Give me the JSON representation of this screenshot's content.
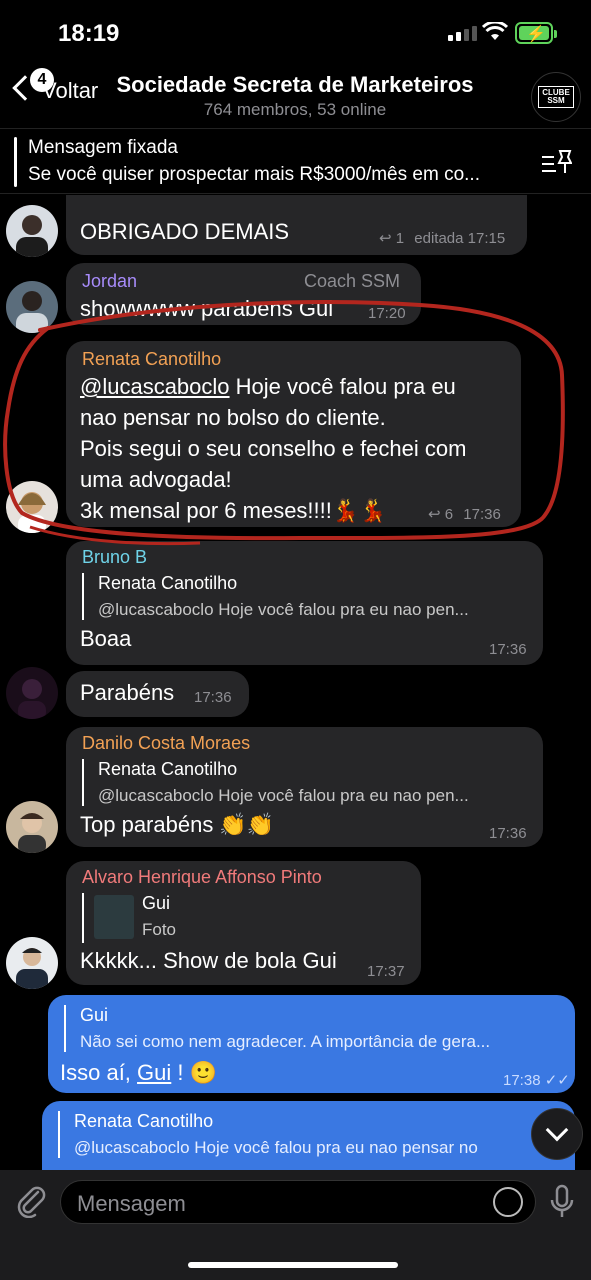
{
  "status": {
    "time": "18:19"
  },
  "header": {
    "back_label": "Voltar",
    "back_badge": "4",
    "title": "Sociedade Secreta de Marketeiros",
    "subtitle": "764 membros, 53 online",
    "avatar_text": "CLUBE SSM"
  },
  "pinned": {
    "title": "Mensagem fixada",
    "text": "Se você quiser prospectar mais R$3000/mês em co..."
  },
  "messages": [
    {
      "text": "OBRIGADO DEMAIS",
      "replies": "1",
      "edited": "editada",
      "time": "17:15"
    },
    {
      "sender": "Jordan",
      "badge": "Coach SSM",
      "text": "showwwww parabens Gui",
      "time": "17:20"
    },
    {
      "sender": "Renata Canotilho",
      "mention": "@lucascaboclo",
      "text1": " Hoje você falou pra eu",
      "text2": "nao pensar no bolso do cliente.",
      "text3": "Pois segui o seu conselho e fechei com",
      "text4": "uma advogada!",
      "text5": "3k mensal por 6 meses!!!!💃💃",
      "replies": "6",
      "time": "17:36"
    },
    {
      "sender": "Bruno B",
      "reply_name": "Renata Canotilho",
      "reply_text": "@lucascaboclo Hoje você falou pra eu nao pen...",
      "text": "Boaa",
      "time": "17:36"
    },
    {
      "text": "Parabéns",
      "time": "17:36"
    },
    {
      "sender": "Danilo Costa Moraes",
      "reply_name": "Renata Canotilho",
      "reply_text": "@lucascaboclo Hoje você falou pra eu nao pen...",
      "text": "Top parabéns 👏👏",
      "time": "17:36"
    },
    {
      "sender": "Alvaro Henrique Affonso Pinto",
      "reply_name": "Gui",
      "reply_text": "Foto",
      "text": "Kkkkk... Show de bola Gui",
      "time": "17:37"
    },
    {
      "reply_name": "Gui",
      "reply_text": "Não sei como nem agradecer. A importância de gera...",
      "text_pre": "Isso aí, ",
      "text_link": "Gui",
      "text_post": " ! 🙂",
      "time": "17:38"
    },
    {
      "reply_name": "Renata Canotilho",
      "reply_text": "@lucascaboclo Hoje você falou pra eu nao pensar no"
    }
  ],
  "input": {
    "placeholder": "Mensagem"
  },
  "colors": {
    "bubble": "#262628",
    "outgoing": "#3a78e2",
    "jordan": "#a78bfa",
    "renata": "#f2a154",
    "bruno": "#6fd3e8",
    "danilo": "#f2a154",
    "alvaro": "#f07a7a",
    "annotation": "#b3261e"
  }
}
